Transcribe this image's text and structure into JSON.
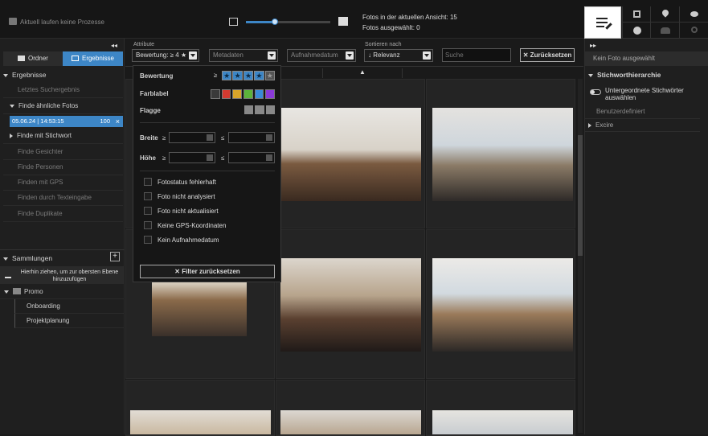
{
  "topbar": {
    "status": "Aktuell laufen keine Prozesse",
    "photos_in_view": "Fotos in der aktuellen Ansicht: 15",
    "photos_selected": "Fotos ausgewählt: 0",
    "slider_level": 0.34
  },
  "left": {
    "tabs": [
      "Ordner",
      "Ergebnisse"
    ],
    "results_header": "Ergebnisse",
    "last_result": "Letztes Suchergebnis",
    "similar": "Finde ähnliche Fotos",
    "active_row": {
      "date": "05.06.24 | 14:53:15",
      "count": "100",
      "close": "×"
    },
    "items": [
      "Finde mit Stichwort",
      "Finde Gesichter",
      "Finde Personen",
      "Finden mit GPS",
      "Finden durch Texteingabe",
      "Finde Duplikate"
    ],
    "collections_header": "Sammlungen",
    "drop_hint": "Hierhin ziehen, um zur obersten Ebene hinzuzufügen",
    "promo": "Promo",
    "children": [
      "Onboarding",
      "Projektplanung"
    ],
    "add": "+"
  },
  "filterbar": {
    "attribute_label": "Attribute",
    "rating": "Bewertung: ≥ 4 ★",
    "metadata": "Metadaten",
    "date": "Aufnahmedatum",
    "sort_label": "Sortieren nach",
    "sort": "↓ Relevanz",
    "search_placeholder": "Suche",
    "reset": "✕  Zurücksetzen"
  },
  "popup": {
    "rating_label": "Bewertung",
    "rating_op": "≥",
    "stars_filled": 4,
    "stars_total": 5,
    "colorlabel": "Farblabel",
    "colors": [
      "#3a3a3a",
      "#d23a30",
      "#d8a52a",
      "#5cb33a",
      "#3a8ad8",
      "#8a3ad8"
    ],
    "flag": "Flagge",
    "width": "Breite",
    "height": "Höhe",
    "gte": "≥",
    "lte": "≤",
    "checkboxes": [
      "Fotostatus fehlerhaft",
      "Foto nicht analysiert",
      "Foto nicht aktualisiert",
      "Keine GPS-Koordinaten",
      "Kein Aufnahmedatum"
    ],
    "reset": "✕  Filter zurücksetzen"
  },
  "right": {
    "no_photo": "Kein Foto ausgewählt",
    "hierarchy": "Stichworthierarchie",
    "toggle": "Untergeordnete Stichwörter auswählen",
    "custom": "Benutzerdefiniert",
    "excire": "Excire"
  }
}
